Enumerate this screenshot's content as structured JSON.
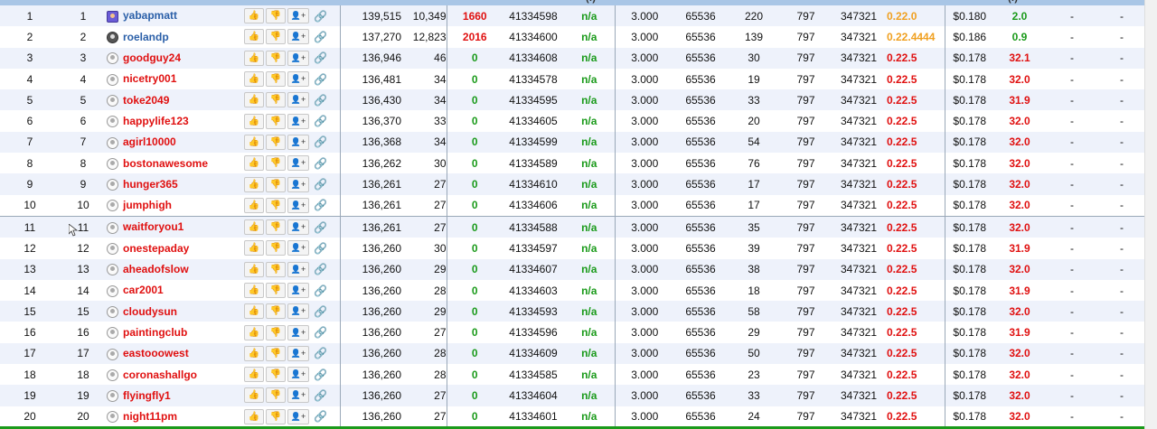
{
  "header_partial": [
    "(!)",
    "(!)"
  ],
  "icons": {
    "up": "thumbs-up-icon",
    "down": "thumbs-down-icon",
    "add": "add-user-icon",
    "link": "link-icon"
  },
  "rows": [
    {
      "rank": "1",
      "rank2": "1",
      "name": "yabapmatt",
      "score": "139,515",
      "n1": "10,349",
      "n2": "1660",
      "block": "41334598",
      "na": "n/a",
      "d": "3.000",
      "p": "65536",
      "q": "220",
      "m": "797",
      "b": "347321",
      "ver": "0.22.0",
      "price": "$0.180",
      "pct": "2.0",
      "x1": "-",
      "x2": "-"
    },
    {
      "rank": "2",
      "rank2": "2",
      "name": "roelandp",
      "score": "137,270",
      "n1": "12,823",
      "n2": "2016",
      "block": "41334600",
      "na": "n/a",
      "d": "3.000",
      "p": "65536",
      "q": "139",
      "m": "797",
      "b": "347321",
      "ver": "0.22.4444",
      "price": "$0.186",
      "pct": "0.9",
      "x1": "-",
      "x2": "-"
    },
    {
      "rank": "3",
      "rank2": "3",
      "name": "goodguy24",
      "score": "136,946",
      "n1": "46",
      "n2": "0",
      "block": "41334608",
      "na": "n/a",
      "d": "3.000",
      "p": "65536",
      "q": "30",
      "m": "797",
      "b": "347321",
      "ver": "0.22.5",
      "price": "$0.178",
      "pct": "32.1",
      "x1": "-",
      "x2": "-"
    },
    {
      "rank": "4",
      "rank2": "4",
      "name": "nicetry001",
      "score": "136,481",
      "n1": "34",
      "n2": "0",
      "block": "41334578",
      "na": "n/a",
      "d": "3.000",
      "p": "65536",
      "q": "19",
      "m": "797",
      "b": "347321",
      "ver": "0.22.5",
      "price": "$0.178",
      "pct": "32.0",
      "x1": "-",
      "x2": "-"
    },
    {
      "rank": "5",
      "rank2": "5",
      "name": "toke2049",
      "score": "136,430",
      "n1": "34",
      "n2": "0",
      "block": "41334595",
      "na": "n/a",
      "d": "3.000",
      "p": "65536",
      "q": "33",
      "m": "797",
      "b": "347321",
      "ver": "0.22.5",
      "price": "$0.178",
      "pct": "31.9",
      "x1": "-",
      "x2": "-"
    },
    {
      "rank": "6",
      "rank2": "6",
      "name": "happylife123",
      "score": "136,370",
      "n1": "33",
      "n2": "0",
      "block": "41334605",
      "na": "n/a",
      "d": "3.000",
      "p": "65536",
      "q": "20",
      "m": "797",
      "b": "347321",
      "ver": "0.22.5",
      "price": "$0.178",
      "pct": "32.0",
      "x1": "-",
      "x2": "-"
    },
    {
      "rank": "7",
      "rank2": "7",
      "name": "agirl10000",
      "score": "136,368",
      "n1": "34",
      "n2": "0",
      "block": "41334599",
      "na": "n/a",
      "d": "3.000",
      "p": "65536",
      "q": "54",
      "m": "797",
      "b": "347321",
      "ver": "0.22.5",
      "price": "$0.178",
      "pct": "32.0",
      "x1": "-",
      "x2": "-"
    },
    {
      "rank": "8",
      "rank2": "8",
      "name": "bostonawesome",
      "score": "136,262",
      "n1": "30",
      "n2": "0",
      "block": "41334589",
      "na": "n/a",
      "d": "3.000",
      "p": "65536",
      "q": "76",
      "m": "797",
      "b": "347321",
      "ver": "0.22.5",
      "price": "$0.178",
      "pct": "32.0",
      "x1": "-",
      "x2": "-"
    },
    {
      "rank": "9",
      "rank2": "9",
      "name": "hunger365",
      "score": "136,261",
      "n1": "27",
      "n2": "0",
      "block": "41334610",
      "na": "n/a",
      "d": "3.000",
      "p": "65536",
      "q": "17",
      "m": "797",
      "b": "347321",
      "ver": "0.22.5",
      "price": "$0.178",
      "pct": "32.0",
      "x1": "-",
      "x2": "-"
    },
    {
      "rank": "10",
      "rank2": "10",
      "name": "jumphigh",
      "score": "136,261",
      "n1": "27",
      "n2": "0",
      "block": "41334606",
      "na": "n/a",
      "d": "3.000",
      "p": "65536",
      "q": "17",
      "m": "797",
      "b": "347321",
      "ver": "0.22.5",
      "price": "$0.178",
      "pct": "32.0",
      "x1": "-",
      "x2": "-"
    },
    {
      "rank": "11",
      "rank2": "11",
      "name": "waitforyou1",
      "score": "136,261",
      "n1": "27",
      "n2": "0",
      "block": "41334588",
      "na": "n/a",
      "d": "3.000",
      "p": "65536",
      "q": "35",
      "m": "797",
      "b": "347321",
      "ver": "0.22.5",
      "price": "$0.178",
      "pct": "32.0",
      "x1": "-",
      "x2": "-"
    },
    {
      "rank": "12",
      "rank2": "12",
      "name": "onestepaday",
      "score": "136,260",
      "n1": "30",
      "n2": "0",
      "block": "41334597",
      "na": "n/a",
      "d": "3.000",
      "p": "65536",
      "q": "39",
      "m": "797",
      "b": "347321",
      "ver": "0.22.5",
      "price": "$0.178",
      "pct": "31.9",
      "x1": "-",
      "x2": "-"
    },
    {
      "rank": "13",
      "rank2": "13",
      "name": "aheadofslow",
      "score": "136,260",
      "n1": "29",
      "n2": "0",
      "block": "41334607",
      "na": "n/a",
      "d": "3.000",
      "p": "65536",
      "q": "38",
      "m": "797",
      "b": "347321",
      "ver": "0.22.5",
      "price": "$0.178",
      "pct": "32.0",
      "x1": "-",
      "x2": "-"
    },
    {
      "rank": "14",
      "rank2": "14",
      "name": "car2001",
      "score": "136,260",
      "n1": "28",
      "n2": "0",
      "block": "41334603",
      "na": "n/a",
      "d": "3.000",
      "p": "65536",
      "q": "18",
      "m": "797",
      "b": "347321",
      "ver": "0.22.5",
      "price": "$0.178",
      "pct": "31.9",
      "x1": "-",
      "x2": "-"
    },
    {
      "rank": "15",
      "rank2": "15",
      "name": "cloudysun",
      "score": "136,260",
      "n1": "29",
      "n2": "0",
      "block": "41334593",
      "na": "n/a",
      "d": "3.000",
      "p": "65536",
      "q": "58",
      "m": "797",
      "b": "347321",
      "ver": "0.22.5",
      "price": "$0.178",
      "pct": "32.0",
      "x1": "-",
      "x2": "-"
    },
    {
      "rank": "16",
      "rank2": "16",
      "name": "paintingclub",
      "score": "136,260",
      "n1": "27",
      "n2": "0",
      "block": "41334596",
      "na": "n/a",
      "d": "3.000",
      "p": "65536",
      "q": "29",
      "m": "797",
      "b": "347321",
      "ver": "0.22.5",
      "price": "$0.178",
      "pct": "31.9",
      "x1": "-",
      "x2": "-"
    },
    {
      "rank": "17",
      "rank2": "17",
      "name": "eastooowest",
      "score": "136,260",
      "n1": "28",
      "n2": "0",
      "block": "41334609",
      "na": "n/a",
      "d": "3.000",
      "p": "65536",
      "q": "50",
      "m": "797",
      "b": "347321",
      "ver": "0.22.5",
      "price": "$0.178",
      "pct": "32.0",
      "x1": "-",
      "x2": "-"
    },
    {
      "rank": "18",
      "rank2": "18",
      "name": "coronashallgo",
      "score": "136,260",
      "n1": "28",
      "n2": "0",
      "block": "41334585",
      "na": "n/a",
      "d": "3.000",
      "p": "65536",
      "q": "23",
      "m": "797",
      "b": "347321",
      "ver": "0.22.5",
      "price": "$0.178",
      "pct": "32.0",
      "x1": "-",
      "x2": "-"
    },
    {
      "rank": "19",
      "rank2": "19",
      "name": "flyingfly1",
      "score": "136,260",
      "n1": "27",
      "n2": "0",
      "block": "41334604",
      "na": "n/a",
      "d": "3.000",
      "p": "65536",
      "q": "33",
      "m": "797",
      "b": "347321",
      "ver": "0.22.5",
      "price": "$0.178",
      "pct": "32.0",
      "x1": "-",
      "x2": "-"
    },
    {
      "rank": "20",
      "rank2": "20",
      "name": "night11pm",
      "score": "136,260",
      "n1": "27",
      "n2": "0",
      "block": "41334601",
      "na": "n/a",
      "d": "3.000",
      "p": "65536",
      "q": "24",
      "m": "797",
      "b": "347321",
      "ver": "0.22.5",
      "price": "$0.178",
      "pct": "32.0",
      "x1": "-",
      "x2": "-"
    }
  ]
}
